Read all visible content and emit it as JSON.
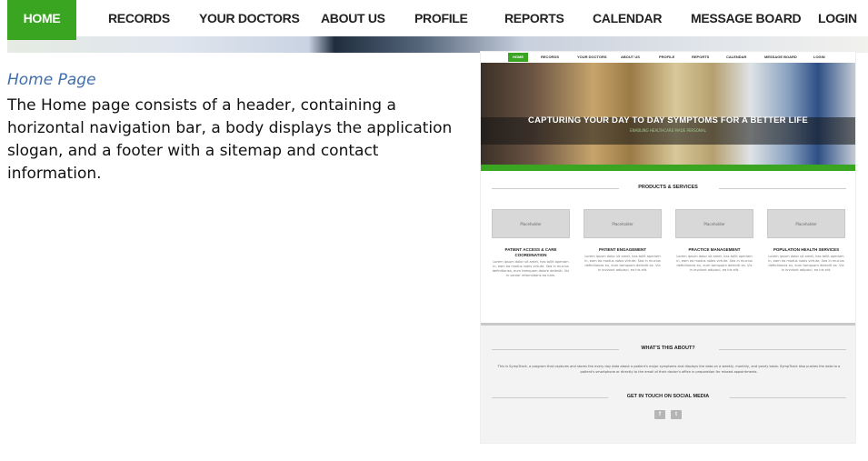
{
  "nav": {
    "items": [
      "HOME",
      "RECORDS",
      "YOUR DOCTORS",
      "ABOUT US",
      "PROFILE",
      "REPORTS",
      "CALENDAR",
      "MESSAGE BOARD",
      "LOGIN"
    ],
    "active": "HOME",
    "active_color": "#3aa521"
  },
  "doc": {
    "heading": "Home Page",
    "body": "The Home page consists of a header, containing a horizontal navigation bar, a body displays the application slogan, and a footer with a sitemap and contact information."
  },
  "mockup": {
    "nav_items": [
      "HOME",
      "RECORDS",
      "YOUR DOCTORS",
      "ABOUT US",
      "PROFILE",
      "REPORTS",
      "CALENDAR",
      "MESSAGE BOARD",
      "LOGIN"
    ],
    "hero_title": "CAPTURING YOUR DAY TO DAY SYMPTOMS FOR A BETTER LIFE",
    "hero_subtitle": "ENABLING HEALTHCARE MADE PERSONAL",
    "products_title": "PRODUCTS & SERVICES",
    "placeholder": "Placeholder",
    "cards": [
      {
        "title": "PATIENT ACCESS & CARE COORDINATION",
        "text": "Lorem ipsum dolor sit amet, has tollit aperiam in, eam ea modus nobis virtute. Sea in mucius definitiones, eum tamquam dolore deleniti. Vix in verear reformidans ea nam."
      },
      {
        "title": "PATIENT ENGAGEMENT",
        "text": "Lorem ipsum dolor sit amet, has tollit aperiam in, eam ea modus nobis virtute. Sea in mucius definitiones eu, eum tamquam deleniti ex. Vix in invidunt adipisci, ea his elit."
      },
      {
        "title": "PRACTICE MANAGEMENT",
        "text": "Lorem ipsum dolor sit amet, has tollit aperiam in, eam ea modus nobis virtute. Sea in mucius definitiones eu, eum tamquam deleniti ex. Vix in invidunt adipisci, ea his elit."
      },
      {
        "title": "POPULATION HEALTH SERVICES",
        "text": "Lorem ipsum dolor sit amet, has tollit aperiam in, eam ea modus nobis virtute. Sea in mucius definitiones eu, eum tamquam deleniti ex. Vix in invidunt adipisci, ea his elit."
      }
    ],
    "about_title": "WHAT'S THIS ABOUT?",
    "about_text": "This is SympTrack, a program that captures and stores the every day data about a patient's major symptoms and displays the data on a weekly, monthly, and yearly basis. SympTrack also pushes the data to a patient's smartphone or directly to the email of their doctor's office in preparation for missed appointments.",
    "social_title": "GET IN TOUCH ON SOCIAL MEDIA",
    "social_icons": [
      "facebook-icon",
      "twitter-icon"
    ]
  }
}
